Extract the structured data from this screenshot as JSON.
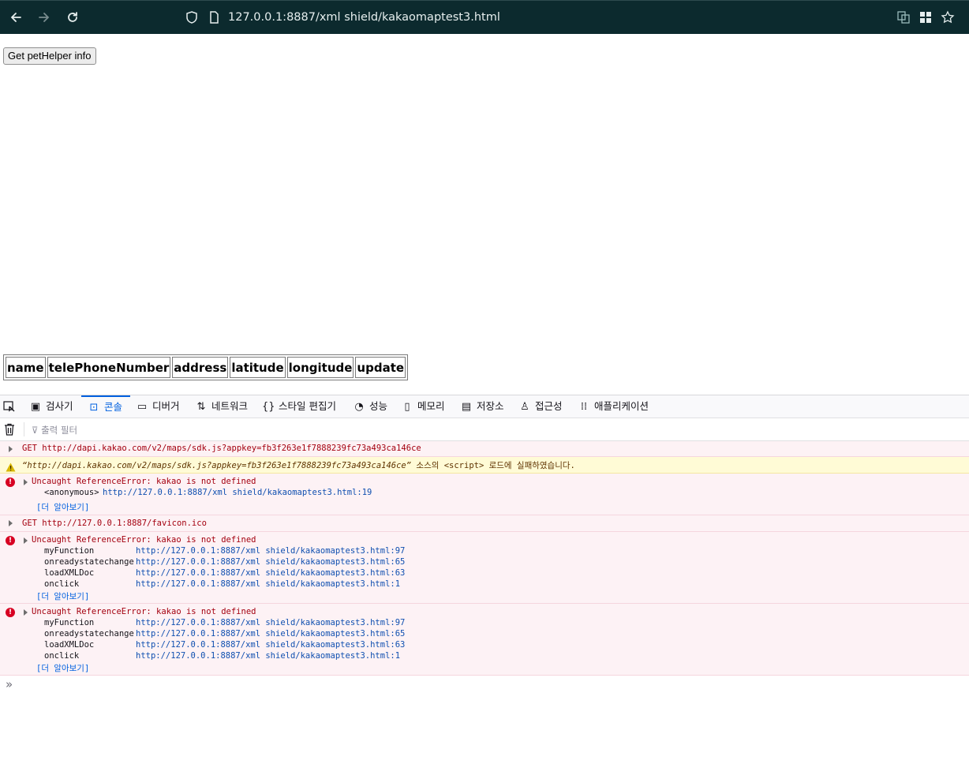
{
  "browser": {
    "url": "127.0.0.1:8887/xml shield/kakaomaptest3.html"
  },
  "page": {
    "button_label": "Get petHelper info",
    "table_headers": [
      "name",
      "telePhoneNumber",
      "address",
      "latitude",
      "longitude",
      "update"
    ]
  },
  "devtools": {
    "tabs": [
      {
        "label": "검사기"
      },
      {
        "label": "콘솔"
      },
      {
        "label": "디버거"
      },
      {
        "label": "네트워크"
      },
      {
        "label": "스타일 편집기"
      },
      {
        "label": "성능"
      },
      {
        "label": "메모리"
      },
      {
        "label": "저장소"
      },
      {
        "label": "접근성"
      },
      {
        "label": "애플리케이션"
      }
    ],
    "filter_placeholder": "출력 필터",
    "messages": {
      "m1": "GET http://dapi.kakao.com/v2/maps/sdk.js?appkey=fb3f263e1f7888239fc73a493ca146ce",
      "m2_url": "“http://dapi.kakao.com/v2/maps/sdk.js?appkey=fb3f263e1f7888239fc73a493ca146ce”",
      "m2_rest": " 소스의 <script> 로드에 실패하였습니다.",
      "e1_title": "Uncaught ReferenceError: kakao is not defined",
      "e1_frame": "<anonymous>",
      "e1_link": "http://127.0.0.1:8887/xml shield/kakaomaptest3.html:19",
      "learn_more": "[더 알아보기]",
      "m4": "GET http://127.0.0.1:8887/favicon.ico",
      "e2_title": "Uncaught ReferenceError: kakao is not defined",
      "e2_frames": [
        "myFunction",
        "onreadystatechange",
        "loadXMLDoc",
        "onclick"
      ],
      "e2_links": [
        "http://127.0.0.1:8887/xml shield/kakaomaptest3.html:97",
        "http://127.0.0.1:8887/xml shield/kakaomaptest3.html:65",
        "http://127.0.0.1:8887/xml shield/kakaomaptest3.html:63",
        "http://127.0.0.1:8887/xml shield/kakaomaptest3.html:1"
      ],
      "e3_title": "Uncaught ReferenceError: kakao is not defined",
      "e3_frames": [
        "myFunction",
        "onreadystatechange",
        "loadXMLDoc",
        "onclick"
      ],
      "e3_links": [
        "http://127.0.0.1:8887/xml shield/kakaomaptest3.html:97",
        "http://127.0.0.1:8887/xml shield/kakaomaptest3.html:65",
        "http://127.0.0.1:8887/xml shield/kakaomaptest3.html:63",
        "http://127.0.0.1:8887/xml shield/kakaomaptest3.html:1"
      ]
    },
    "prompt_symbol": "»"
  }
}
